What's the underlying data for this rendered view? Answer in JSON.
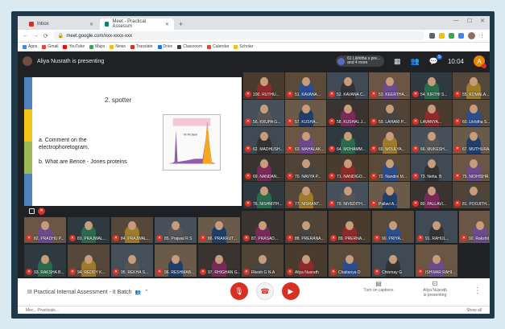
{
  "browser": {
    "tabs": [
      {
        "label": "Inbox",
        "active": false,
        "color": "#d93025"
      },
      {
        "label": "Meet - Practical Assessm",
        "active": true,
        "color": "#00897b"
      }
    ],
    "url": "meet.google.com/xxx-xxxx-xxx",
    "bookmarks": [
      "Apps",
      "Gmail",
      "YouTube",
      "Maps",
      "News",
      "Translate",
      "Drive",
      "Classroom",
      "Calendar",
      "Scholar"
    ]
  },
  "meet": {
    "presenting_text": "Aliya Nusrath is presenting",
    "participants_badge": [
      "61 Likhitha s pre...",
      "and 4 more"
    ],
    "chat_count": "5",
    "clock": "10:04",
    "self_initial": "A"
  },
  "slide": {
    "title": "2. spotter",
    "question1": "a. Comment on the electrophoretogram.",
    "question2": "b. What are Bence - Jones proteins",
    "colors": [
      "#4f81bd",
      "#f5c518",
      "#9bbb59",
      "#4f81bd"
    ]
  },
  "presenter_tile_name": "",
  "tiles_right": [
    "100. RUTHU...",
    "51. KAVANA...",
    "52. KAVANA C...",
    "53. KEERTHA...",
    "54. KIRTHI S...",
    "55. KOMALA...",
    "56. KRUPA G...",
    "57. KUSHA...",
    "58. KUSHAL J...",
    "59. LAHARI P...",
    "LAVANYA...",
    "60. Likhitha S...",
    "62. MADHUSH...",
    "63. MAHALAK...",
    "64. MOHAMM...",
    "65. MOULYA...",
    "66. MUKESH...",
    "67. MUTHURAJ...",
    "69. NANDAN...",
    "70. NAVYA P...",
    "71. NANDIGO...",
    "72. Nandini M...",
    "73. Neha. B",
    "75. NIDHISHR...",
    "76. NISHMITH...",
    "77. NISHANT...",
    "79. NIVEDITH...",
    "Pallavi A...",
    "80. PALLAVI...",
    "81. POOJITH..."
  ],
  "tiles_bottom": [
    "82. PRADHU P...",
    "83. PRAJWAL...",
    "84. PRAJWAL...",
    "85. Prajwal R S",
    "86. PRAKRUT...",
    "87. PRASAD...",
    "88. PRERANA...",
    "89. PRERNA...",
    "90. PRIYA...",
    "91. RAHUL...",
    "92. Rakshit H S",
    "93. RAKSHA B...",
    "94. REDDY K...",
    "95. REKHA S...",
    "96. RESHMAB...",
    "97. RHIGHAN G...",
    "Rkesh G N.A",
    "Aliya Nusrath",
    "Chaitanya D",
    "Chinmay G",
    "ISHWAR RAHI..."
  ],
  "bottom": {
    "meeting_title": "III Practical Internal Assessment - II Batch",
    "turn_on_captions": "Turn on captions",
    "presenting_label": [
      "Aliya Nusrath",
      "is presenting"
    ]
  },
  "downloadbar": {
    "file": "Mec... Practicals...",
    "show_all": "Show all"
  }
}
